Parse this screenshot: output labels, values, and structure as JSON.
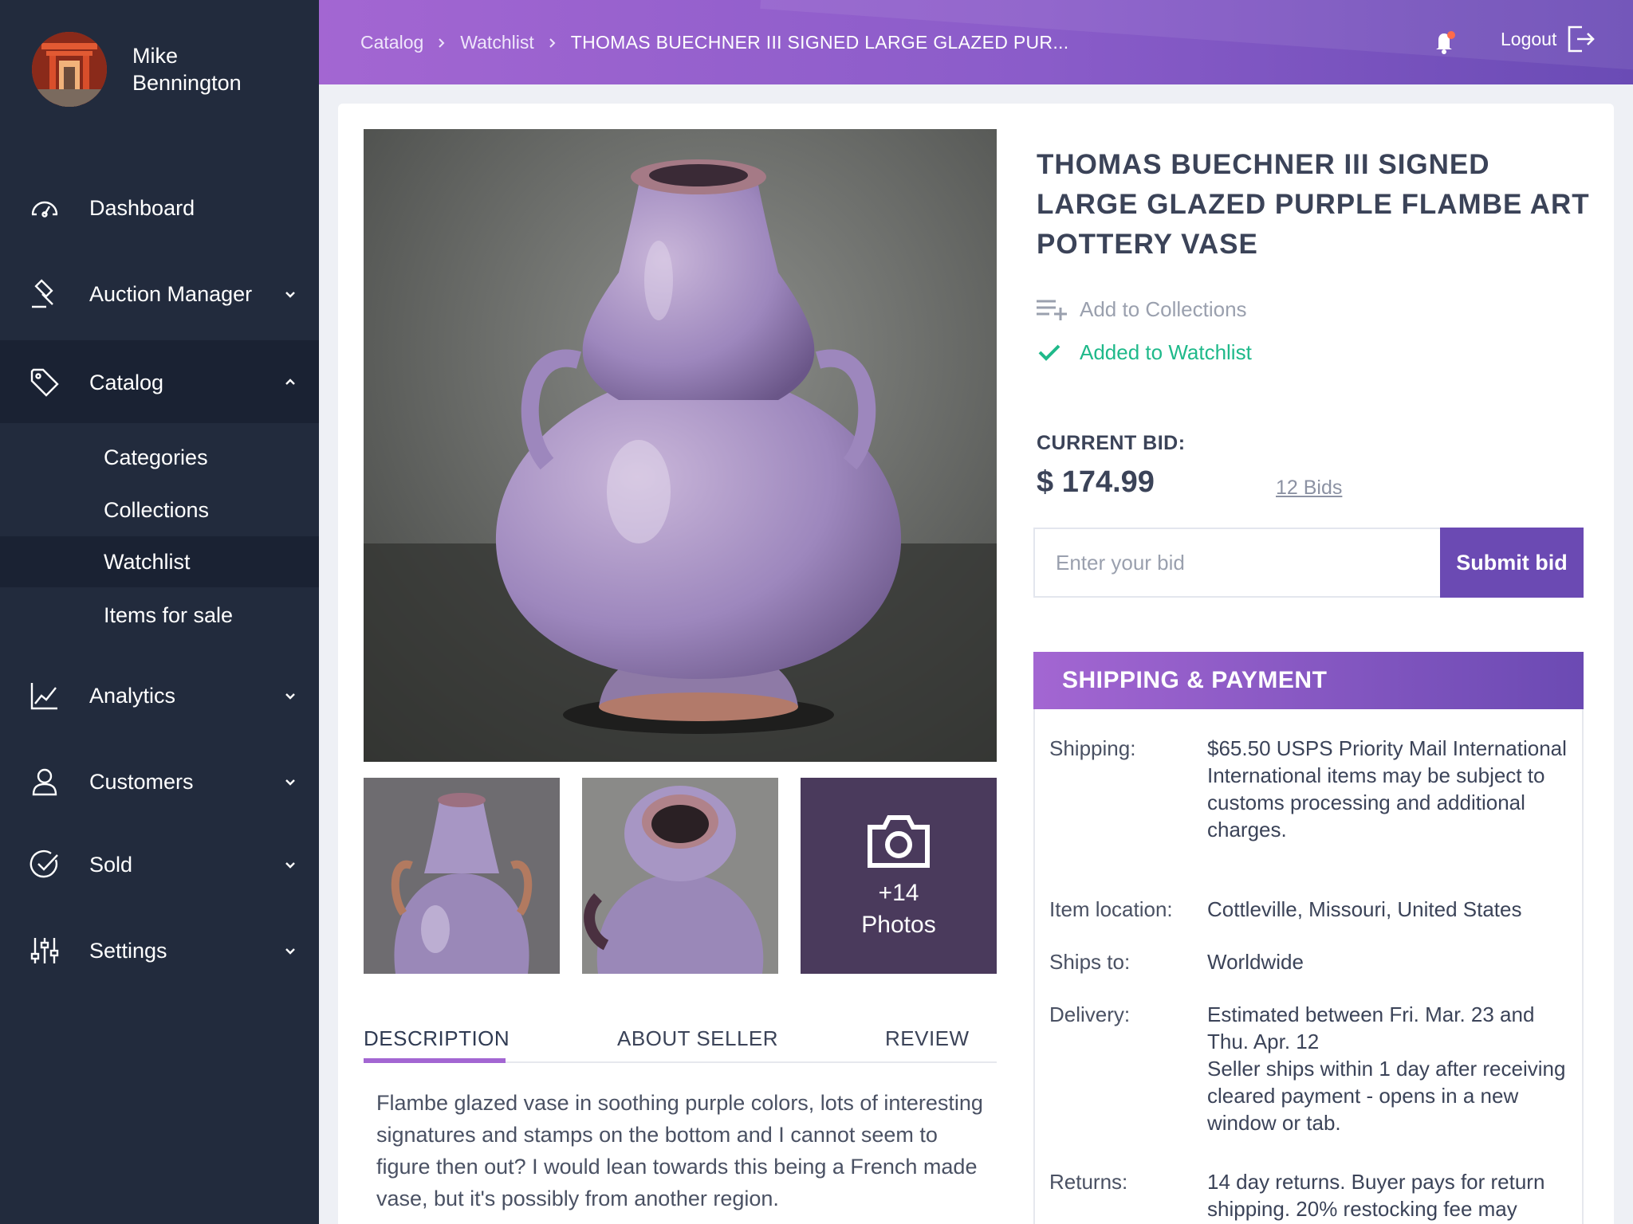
{
  "user": {
    "first_name": "Mike",
    "last_name": "Bennington"
  },
  "nav": {
    "dashboard": "Dashboard",
    "auction_manager": "Auction Manager",
    "catalog": "Catalog",
    "catalog_sub": [
      "Categories",
      "Collections",
      "Watchlist",
      "Items for sale"
    ],
    "analytics": "Analytics",
    "customers": "Customers",
    "sold": "Sold",
    "settings": "Settings"
  },
  "header": {
    "breadcrumbs": [
      "Catalog",
      "Watchlist",
      "THOMAS BUECHNER III SIGNED LARGE GLAZED PUR..."
    ],
    "logout": "Logout"
  },
  "product": {
    "title": "THOMAS BUECHNER III SIGNED LARGE GLAZED PURPLE FLAMBE ART POTTERY VASE",
    "add_collections": "Add to Collections",
    "added_watchlist": "Added to Watchlist",
    "current_bid_label": "CURRENT BID:",
    "current_bid": "$ 174.99",
    "bids_link": "12 Bids",
    "bid_placeholder": "Enter your bid",
    "submit_bid": "Submit bid",
    "more_photos_count": "+14",
    "more_photos_label": "Photos"
  },
  "tabs": [
    "DESCRIPTION",
    "ABOUT SELLER",
    "REVIEW"
  ],
  "description": "Flambe glazed vase in soothing purple colors, lots of interesting signatures and stamps on the bottom and I cannot seem to figure then out? I would lean towards this being a French made vase, but it's possibly from another region.",
  "shipping": {
    "heading": "SHIPPING & PAYMENT",
    "rows": [
      {
        "key": "Shipping:",
        "lines": [
          "$65.50 USPS Priority Mail International",
          "International items may be subject to customs processing and additional charges."
        ]
      },
      {
        "key": "Item location:",
        "lines": [
          "Cottleville, Missouri, United States"
        ]
      },
      {
        "key": "Ships to:",
        "lines": [
          "Worldwide"
        ]
      },
      {
        "key": "Delivery:",
        "lines": [
          "Estimated between Fri. Mar. 23 and Thu. Apr. 12",
          "Seller ships within 1 day after receiving cleared payment - opens in a new window or tab."
        ]
      },
      {
        "key": "Returns:",
        "lines": [
          "14 day returns. Buyer pays for return shipping. 20% restocking fee may"
        ]
      }
    ]
  },
  "colors": {
    "sidebar": "#222b3d",
    "accent": "#6b4ab3",
    "header_start": "#a366d2",
    "success": "#1fb98a"
  }
}
